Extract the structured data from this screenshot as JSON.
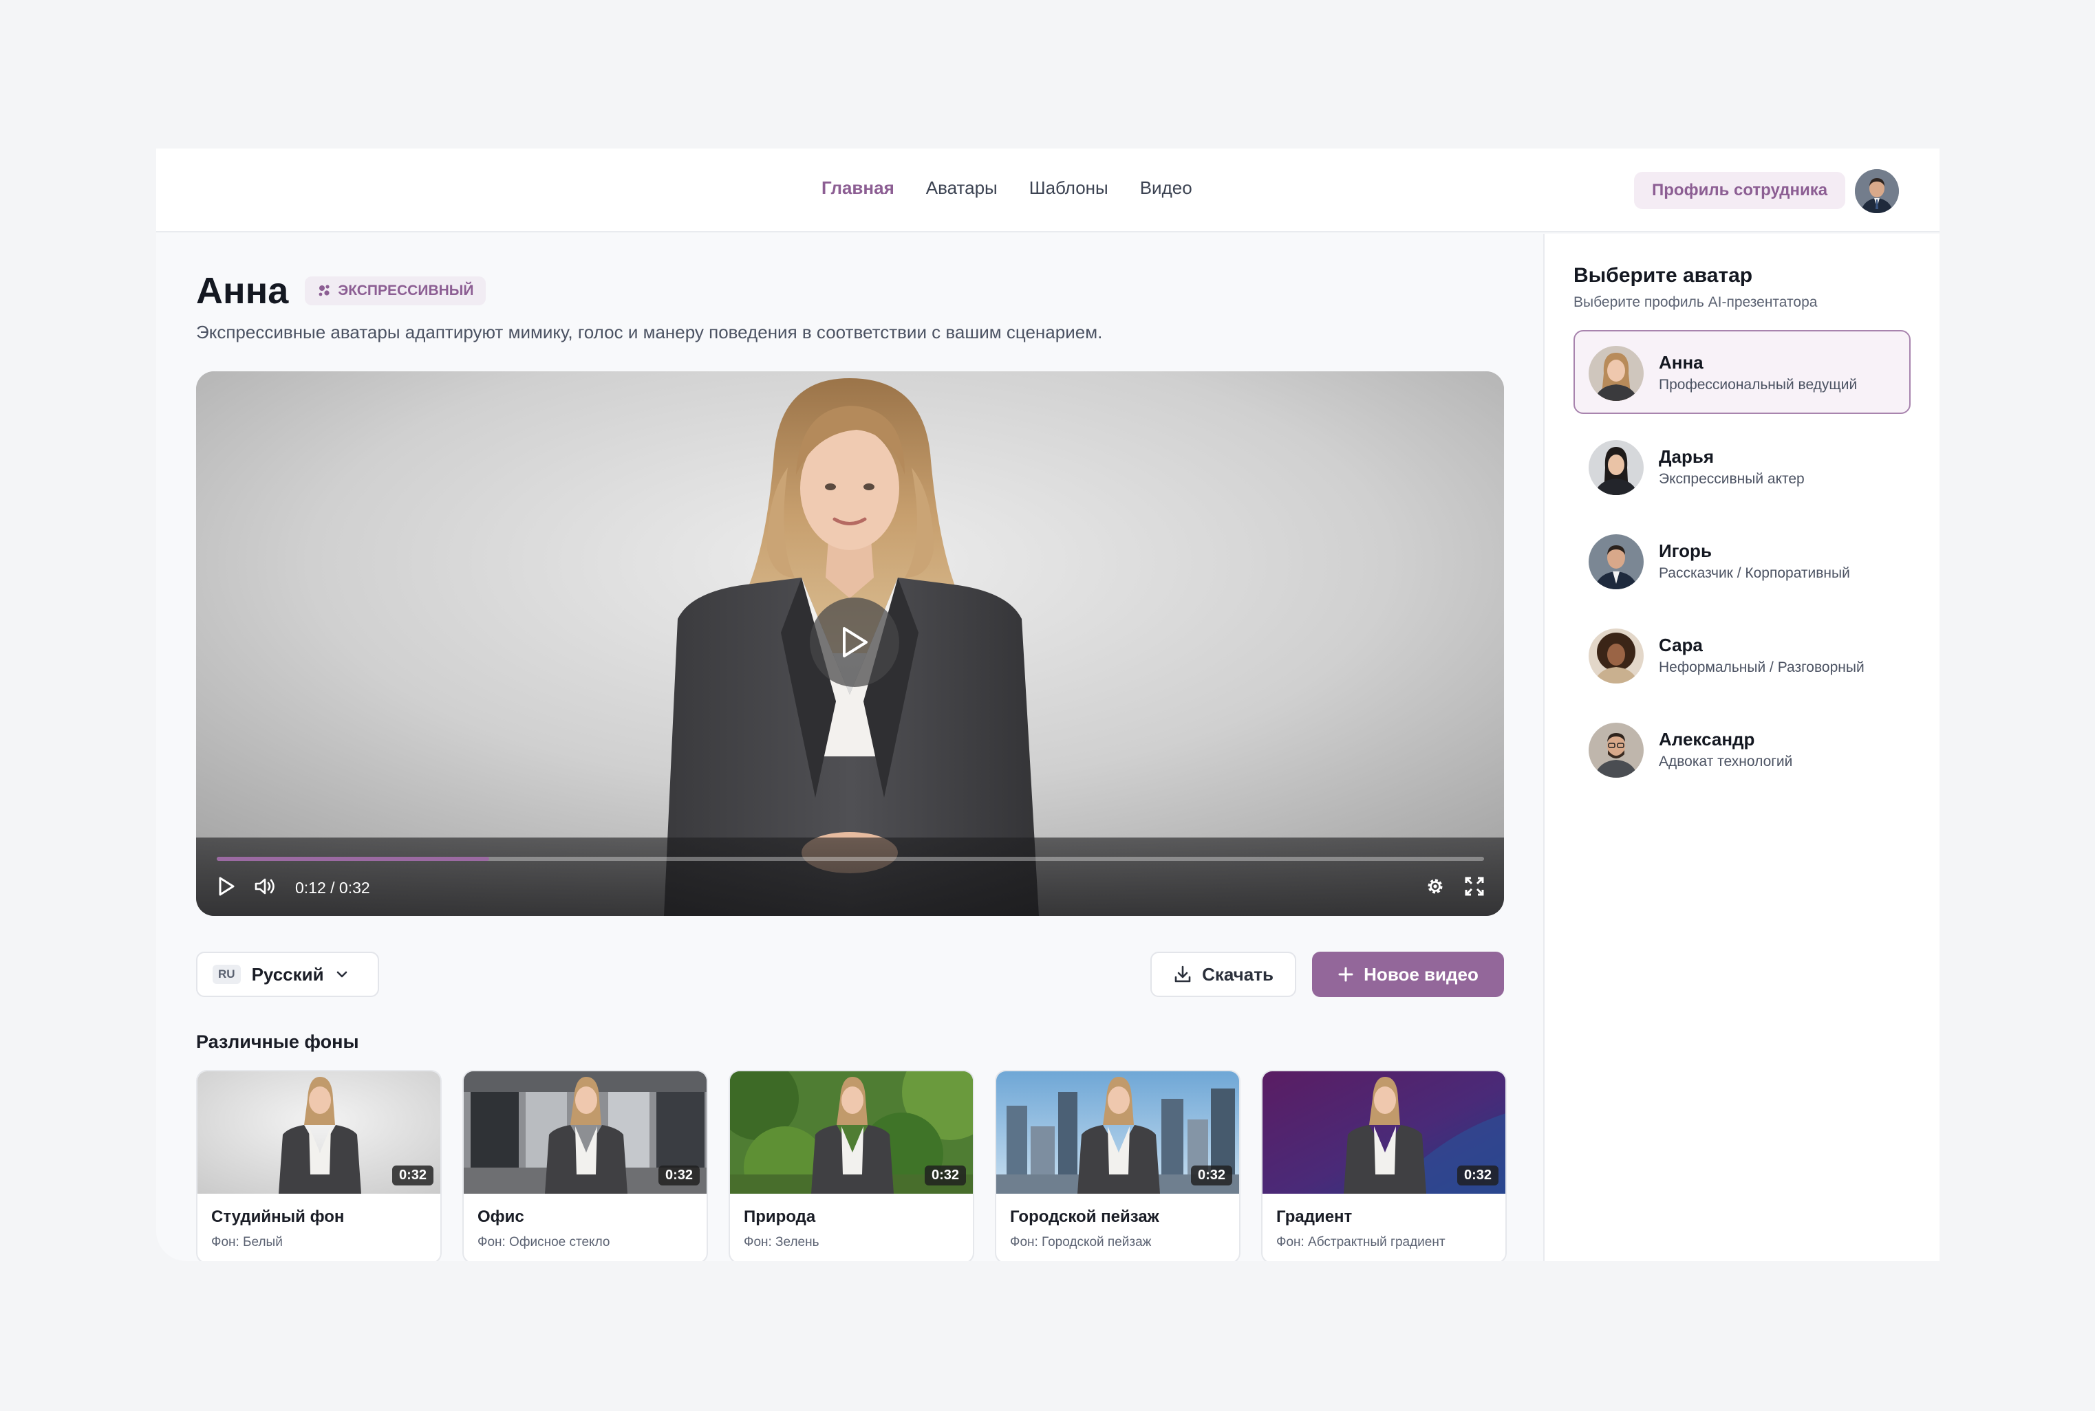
{
  "nav": {
    "items": [
      {
        "label": "Главная",
        "active": true
      },
      {
        "label": "Аватары",
        "active": false
      },
      {
        "label": "Шаблоны",
        "active": false
      },
      {
        "label": "Видео",
        "active": false
      }
    ],
    "profile_button": "Профиль сотрудника",
    "user_avatar_icon": "user-avatar"
  },
  "main": {
    "title": "Анна",
    "badge": {
      "label": "ЭКСПРЕССИВНЫЙ",
      "icon": "sparkle-icon"
    },
    "subtitle": "Экспрессивные аватары адаптируют мимику, голос и манеру поведения в соответствии с вашим сценарием.",
    "player": {
      "time": "0:12 / 0:32",
      "progress": 0.215,
      "icons": [
        "play-icon",
        "volume-icon",
        "settings-icon",
        "fullscreen-icon"
      ]
    },
    "language": {
      "code": "RU",
      "label": "Русский"
    },
    "download_label": "Скачать",
    "new_video_label": "Новое видео",
    "backgrounds_title": "Различные фоны",
    "backgrounds": [
      {
        "name": "Студийный фон",
        "desc": "Фон: Белый",
        "duration": "0:32"
      },
      {
        "name": "Офис",
        "desc": "Фон: Офисное стекло",
        "duration": "0:32"
      },
      {
        "name": "Природа",
        "desc": "Фон: Зелень",
        "duration": "0:32"
      },
      {
        "name": "Городской пейзаж",
        "desc": "Фон: Городской пейзаж",
        "duration": "0:32"
      },
      {
        "name": "Градиент",
        "desc": "Фон: Абстрактный градиент",
        "duration": "0:32"
      }
    ]
  },
  "sidebar": {
    "title": "Выберите аватар",
    "subtitle": "Выберите профиль AI-презентатора",
    "avatars": [
      {
        "name": "Анна",
        "role": "Профессиональный ведущий",
        "selected": true
      },
      {
        "name": "Дарья",
        "role": "Экспрессивный актер",
        "selected": false
      },
      {
        "name": "Игорь",
        "role": "Рассказчик / Корпоративный",
        "selected": false
      },
      {
        "name": "Сара",
        "role": "Неформальный / Разговорный",
        "selected": false
      },
      {
        "name": "Александр",
        "role": "Адвокат технологий",
        "selected": false
      }
    ]
  },
  "colors": {
    "accent": "#93679a",
    "accent_text": "#8c5e93",
    "accent_bg": "#f4ecf4"
  }
}
